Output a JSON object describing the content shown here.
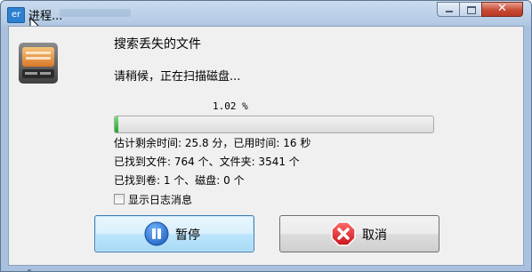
{
  "window": {
    "app_icon_text": "er",
    "title": "进程..."
  },
  "heading": "搜索丢失的文件",
  "status": "请稍候，正在扫描磁盘...",
  "progress": {
    "percent_text": "1.02 %",
    "value": 0.0102
  },
  "info": {
    "time": "估计剩余时间: 25.8 分，已用时间: 16 秒",
    "files": "已找到文件: 764 个、文件夹: 3541 个",
    "volumes": "已找到卷: 1 个、磁盘: 0 个"
  },
  "log_checkbox": {
    "label": "显示日志消息",
    "checked": false
  },
  "buttons": {
    "pause": "暂停",
    "cancel": "取消"
  },
  "colors": {
    "progress_fill": "#1fa329",
    "pause_icon": "#1f5fbf",
    "cancel_icon": "#d0202a"
  },
  "icons": {
    "app": "app-icon",
    "disk": "hard-disk-icon",
    "pause": "pause-icon",
    "cancel": "cancel-x-icon",
    "cursor": "mouse-cursor-icon"
  }
}
